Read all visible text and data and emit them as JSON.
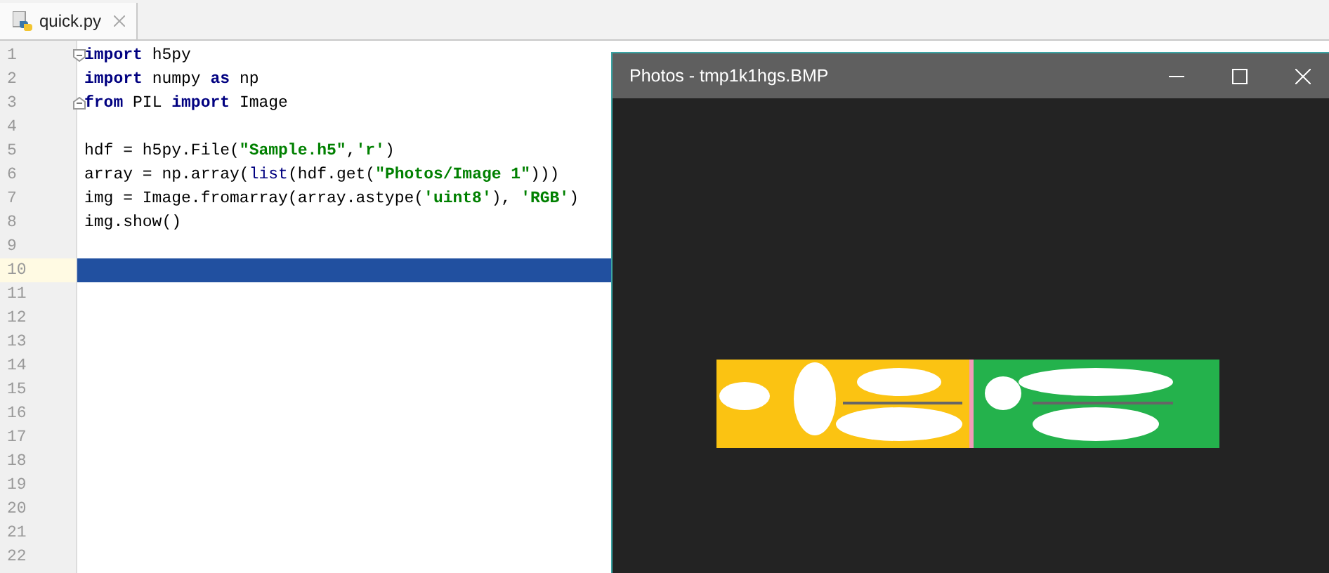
{
  "tabs": [
    {
      "label": "quick.py",
      "selected": true,
      "closable": true
    }
  ],
  "editor": {
    "lines": [
      {
        "number": "1",
        "fold_start": true,
        "tokens": [
          {
            "kind": "kw",
            "text": "import"
          },
          {
            "kind": "plain",
            "text": " h5py"
          }
        ]
      },
      {
        "number": "2",
        "tokens": [
          {
            "kind": "kw",
            "text": "import"
          },
          {
            "kind": "plain",
            "text": " numpy "
          },
          {
            "kind": "kw",
            "text": "as"
          },
          {
            "kind": "plain",
            "text": " np"
          }
        ]
      },
      {
        "number": "3",
        "fold_end": true,
        "tokens": [
          {
            "kind": "kw",
            "text": "from"
          },
          {
            "kind": "plain",
            "text": " PIL "
          },
          {
            "kind": "kw",
            "text": "import"
          },
          {
            "kind": "plain",
            "text": " Image"
          }
        ]
      },
      {
        "number": "4"
      },
      {
        "number": "5",
        "tokens": [
          {
            "kind": "plain",
            "text": "hdf = h5py.File("
          },
          {
            "kind": "str",
            "text": "\"Sample.h5\""
          },
          {
            "kind": "plain",
            "text": ","
          },
          {
            "kind": "str",
            "text": "'r'"
          },
          {
            "kind": "plain",
            "text": ")"
          }
        ]
      },
      {
        "number": "6",
        "tokens": [
          {
            "kind": "plain",
            "text": "array = np.array("
          },
          {
            "kind": "builtin",
            "text": "list"
          },
          {
            "kind": "plain",
            "text": "(hdf.get("
          },
          {
            "kind": "str",
            "text": "\"Photos/Image 1\""
          },
          {
            "kind": "plain",
            "text": ")))"
          }
        ]
      },
      {
        "number": "7",
        "tokens": [
          {
            "kind": "plain",
            "text": "img = Image.fromarray(array.astype("
          },
          {
            "kind": "str",
            "text": "'uint8'"
          },
          {
            "kind": "plain",
            "text": "), "
          },
          {
            "kind": "str",
            "text": "'RGB'"
          },
          {
            "kind": "plain",
            "text": ")"
          }
        ]
      },
      {
        "number": "8",
        "tokens": [
          {
            "kind": "plain",
            "text": "img.show()"
          }
        ]
      },
      {
        "number": "9"
      },
      {
        "number": "10",
        "current": true
      },
      {
        "number": "11"
      },
      {
        "number": "12"
      },
      {
        "number": "13"
      },
      {
        "number": "14"
      },
      {
        "number": "15"
      },
      {
        "number": "16"
      },
      {
        "number": "17"
      },
      {
        "number": "18"
      },
      {
        "number": "19"
      },
      {
        "number": "20"
      },
      {
        "number": "21"
      },
      {
        "number": "22"
      }
    ]
  },
  "photos_window": {
    "title": "Photos - tmp1k1hgs.BMP"
  }
}
